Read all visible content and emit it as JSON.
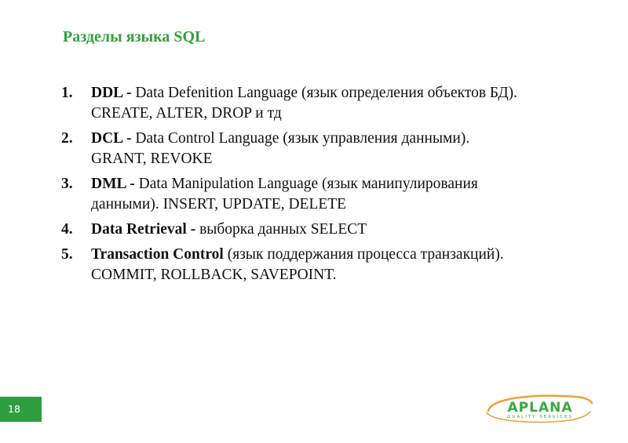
{
  "slide": {
    "title": "Разделы языка SQL",
    "page_number": "18"
  },
  "list": {
    "items": [
      {
        "number": "1.",
        "term": "DDL -",
        "lines": [
          " Data Defenition Language (язык определения объектов БД).",
          "CREATE, ALTER, DROP и тд"
        ]
      },
      {
        "number": "2.",
        "term": "DCL -",
        "lines": [
          " Data Control Language (язык управления данными).",
          "GRANT, REVOKE"
        ]
      },
      {
        "number": "3.",
        "term": "DML -",
        "lines": [
          " Data Manipulation Language (язык манипулирования",
          "данными). INSERT, UPDATE, DELETE"
        ]
      },
      {
        "number": "4.",
        "term": "Data Retrieval -",
        "lines": [
          " выборка данных SELECT"
        ]
      },
      {
        "number": "5.",
        "term": "Transaction Control",
        "lines": [
          " (язык поддержания процесса транзакций).",
          "COMMIT, ROLLBACK, SAVEPOINT."
        ]
      }
    ]
  },
  "logo": {
    "name": "APLANA",
    "tagline": "QUALITY SERVICES",
    "text_color": "#3aa83c",
    "swoosh_color": "#f0a030"
  },
  "colors": {
    "title": "#33a03d",
    "badge": "#2f9e3f"
  }
}
